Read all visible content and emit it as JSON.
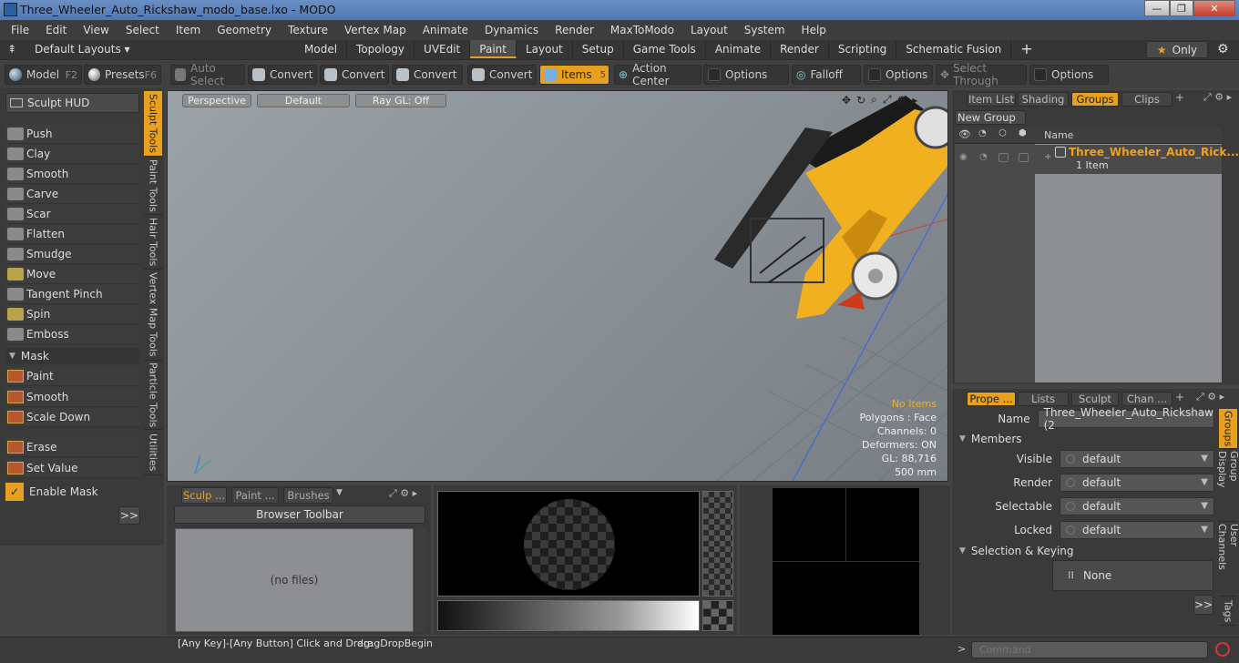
{
  "window": {
    "title": "Three_Wheeler_Auto_Rickshaw_modo_base.lxo - MODO",
    "min": "—",
    "max": "❐",
    "close": "✕"
  },
  "menu": [
    "File",
    "Edit",
    "View",
    "Select",
    "Item",
    "Geometry",
    "Texture",
    "Vertex Map",
    "Animate",
    "Dynamics",
    "Render",
    "MaxToModo",
    "Layout",
    "System",
    "Help"
  ],
  "layoutbar": {
    "layouts_label": "Default Layouts ▾",
    "tabs": [
      "Model",
      "Topology",
      "UVEdit",
      "Paint",
      "Layout",
      "Setup",
      "Game Tools",
      "Animate",
      "Render",
      "Scripting",
      "Schematic Fusion"
    ],
    "active_tab": "Paint",
    "only_label": "Only"
  },
  "toolbar": {
    "model": "Model",
    "model_key": "F2",
    "presets": "Presets",
    "presets_key": "F6",
    "auto_select": "Auto Select",
    "convert1": "Convert",
    "convert2": "Convert",
    "convert3": "Convert",
    "convert4": "Convert",
    "items": "Items",
    "items_badge": "5",
    "action_center": "Action Center",
    "options1": "Options",
    "falloff": "Falloff",
    "options2": "Options",
    "select_through": "Select Through",
    "options3": "Options"
  },
  "left": {
    "sculpt_hud": "Sculpt HUD",
    "tools": [
      "Push",
      "Clay",
      "Smooth",
      "Carve",
      "Scar",
      "Flatten",
      "Smudge",
      "Move",
      "Tangent Pinch",
      "Spin",
      "Emboss"
    ],
    "mask_header": "Mask",
    "mask_tools": [
      "Paint",
      "Smooth",
      "Scale Down"
    ],
    "erase": "Erase",
    "set_value": "Set Value",
    "enable_mask": "Enable Mask",
    "more": ">>"
  },
  "vtabs": [
    "Sculpt Tools",
    "Paint Tools",
    "Hair Tools",
    "Vertex Map Tools",
    "Particle Tools",
    "Utilities"
  ],
  "viewport": {
    "perspective": "Perspective",
    "default": "Default",
    "raygl": "Ray GL: Off",
    "hud": {
      "no_items": "No Items",
      "polygons": "Polygons : Face",
      "channels": "Channels: 0",
      "deformers": "Deformers: ON",
      "gl": "GL: 88,716",
      "size": "500 mm"
    }
  },
  "groups_panel": {
    "tabs": [
      "Item List",
      "Shading",
      "Groups",
      "Clips"
    ],
    "new_group": "New Group",
    "name_col": "Name",
    "row_name": "Three_Wheeler_Auto_Rick...",
    "row_sub": "1 Item"
  },
  "properties": {
    "tabs": [
      "Prope ...",
      "Lists",
      "Sculpt",
      "Chan ..."
    ],
    "side_tabs": [
      "Groups",
      "Group Display",
      "User Channels",
      "Tags"
    ],
    "name_label": "Name",
    "name_value": "Three_Wheeler_Auto_Rickshaw (2",
    "members": "Members",
    "rows": [
      {
        "label": "Visible",
        "value": "default"
      },
      {
        "label": "Render",
        "value": "default"
      },
      {
        "label": "Selectable",
        "value": "default"
      },
      {
        "label": "Locked",
        "value": "default"
      }
    ],
    "selection_keying": "Selection & Keying",
    "none": "None",
    "more": ">>"
  },
  "brushes": {
    "tabs": [
      "Sculp ...",
      "Paint ...",
      "Brushes"
    ],
    "browser_toolbar": "Browser Toolbar",
    "no_files": "(no files)"
  },
  "status": {
    "hint_key": "[Any Key]-[Any Button] Click and Drag:",
    "hint_action": "dragDropBegin",
    "command_placeholder": "Command"
  },
  "colors": {
    "accent": "#e8a020",
    "vehicle": "#f0b020"
  }
}
